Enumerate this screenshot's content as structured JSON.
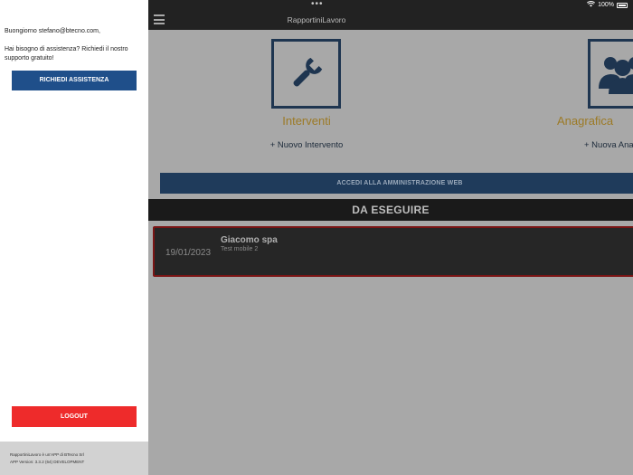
{
  "status": {
    "battery": "100%"
  },
  "navbar": {
    "title": "RapportiniLavoro"
  },
  "tiles": [
    {
      "label": "Interventi",
      "link": "+ Nuovo Intervento",
      "icon": "wrench-icon"
    },
    {
      "label": "Anagrafica",
      "link": "+ Nuova Ana",
      "icon": "people-icon"
    }
  ],
  "admin_button": "ACCEDI ALLA AMMINISTRAZIONE WEB",
  "section_title": "DA ESEGUIRE",
  "tasks": [
    {
      "date": "19/01/2023",
      "title": "Giacomo spa",
      "subtitle": "Test mobile 2"
    }
  ],
  "drawer": {
    "greeting": "Buongiorno stefano@btecno.com,",
    "help_text": "Hai bisogno di assistenza? Richiedi il nostro supporto gratuito!",
    "assist_button": "RICHIEDI ASSISTENZA",
    "logout_button": "LOGOUT",
    "footer_line1": "RapportiniLavoro è un'APP di BTecno Srl",
    "footer_line2": "APP Version: 3.3.2 (64) DEVELOPMENT"
  },
  "colors": {
    "drawer_bg": "#ffffff",
    "assist_button": "#1f4f8a",
    "logout_button": "#ee2b2b",
    "tile_label": "#9c7a26",
    "admin_button": "#1f3b5b",
    "task_border": "#7a1515"
  }
}
